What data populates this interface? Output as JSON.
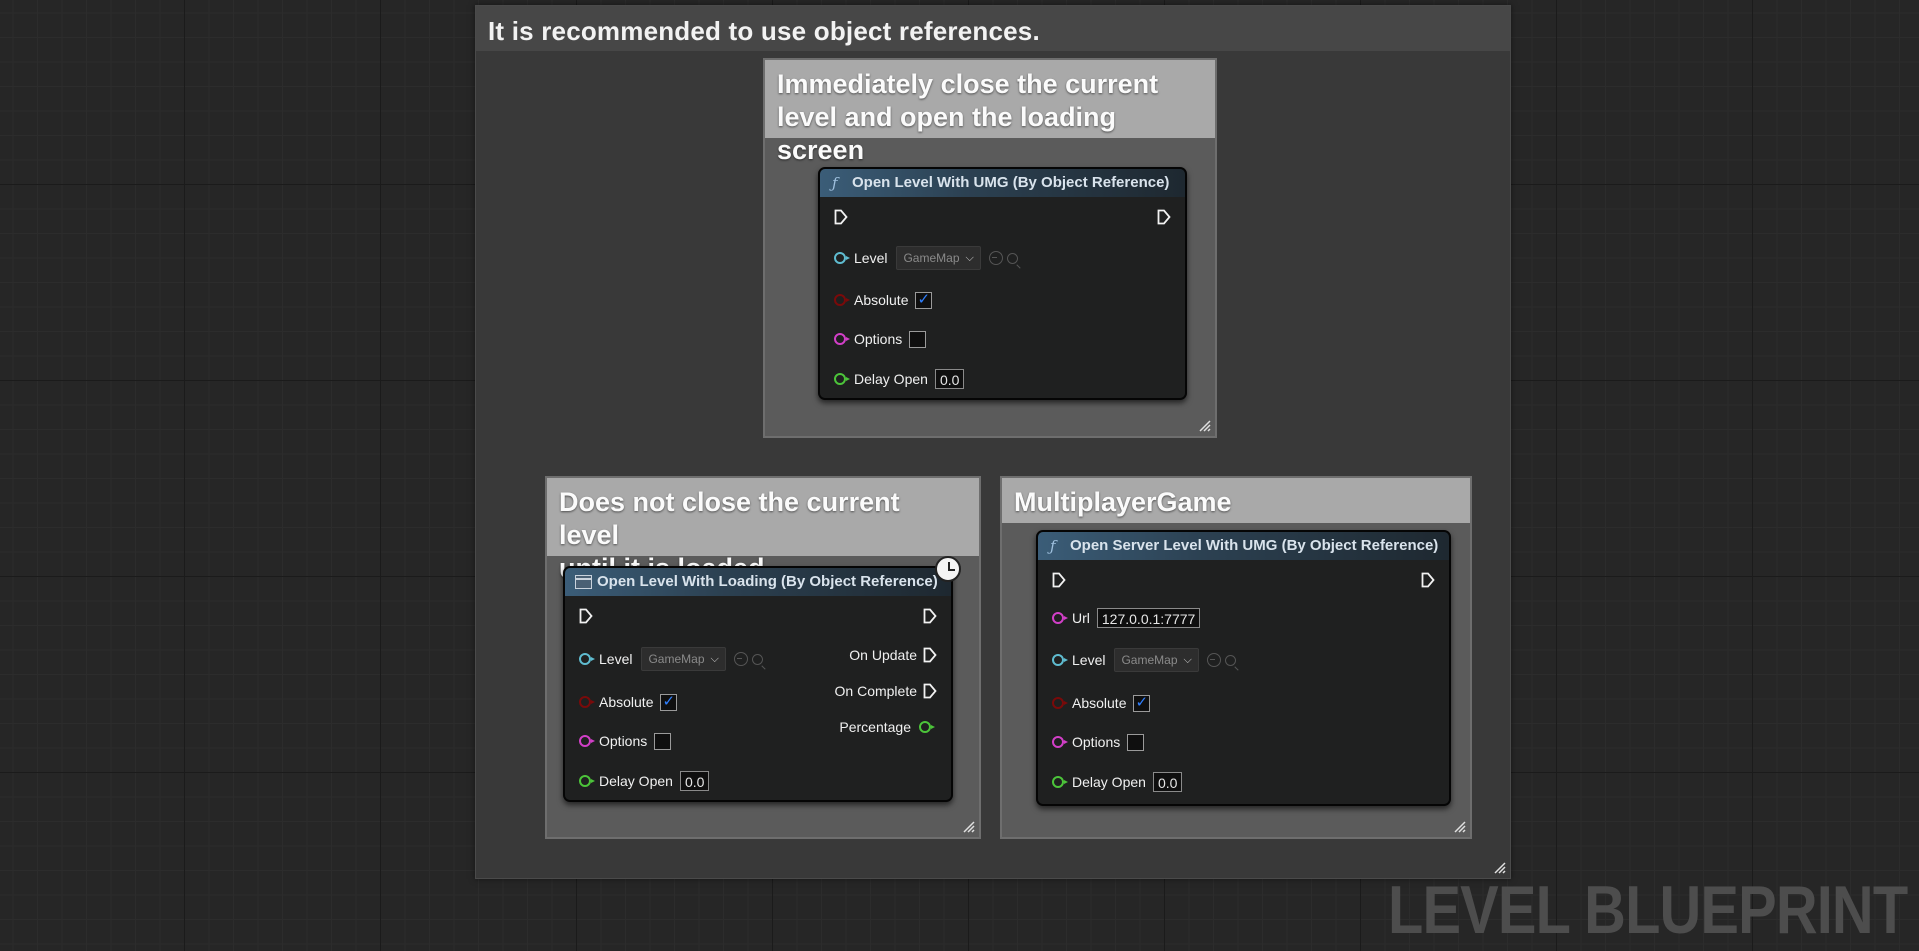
{
  "outer_comment": {
    "title": "It is recommended to use object references."
  },
  "comment_immediate": {
    "title_line1": "Immediately close the current",
    "title_line2": "level and open the loading screen"
  },
  "comment_loading": {
    "title_line1": "Does not close the current level",
    "title_line2": "until it is loaded"
  },
  "comment_multiplayer": {
    "title": "MultiplayerGame"
  },
  "node_open_level_umg": {
    "title": "Open Level With UMG (By Object Reference)",
    "icon": "function-icon",
    "level_label": "Level",
    "level_value": "GameMap",
    "absolute_label": "Absolute",
    "absolute_checked": true,
    "options_label": "Options",
    "options_checked": false,
    "delay_label": "Delay Open",
    "delay_value": "0.0"
  },
  "node_open_level_loading": {
    "title": "Open Level With Loading (By Object Reference)",
    "icon": "macro-icon",
    "level_label": "Level",
    "level_value": "GameMap",
    "absolute_label": "Absolute",
    "absolute_checked": true,
    "options_label": "Options",
    "options_checked": false,
    "delay_label": "Delay Open",
    "delay_value": "0.0",
    "on_update_label": "On Update",
    "on_complete_label": "On Complete",
    "percentage_label": "Percentage"
  },
  "node_open_server_level": {
    "title": "Open Server Level With UMG (By Object Reference)",
    "icon": "function-icon",
    "url_label": "Url",
    "url_value": "127.0.0.1:7777",
    "level_label": "Level",
    "level_value": "GameMap",
    "absolute_label": "Absolute",
    "absolute_checked": true,
    "options_label": "Options",
    "options_checked": false,
    "delay_label": "Delay Open",
    "delay_value": "0.0"
  },
  "watermark": "LEVEL BLUEPRINT",
  "colors": {
    "pin_object": "#5fbcd0",
    "pin_bool": "#7a0a0a",
    "pin_string": "#d23fc8",
    "pin_float": "#4cc43a",
    "checkbox_check": "#2f7fff",
    "comment_header": "#a9a9a9"
  }
}
